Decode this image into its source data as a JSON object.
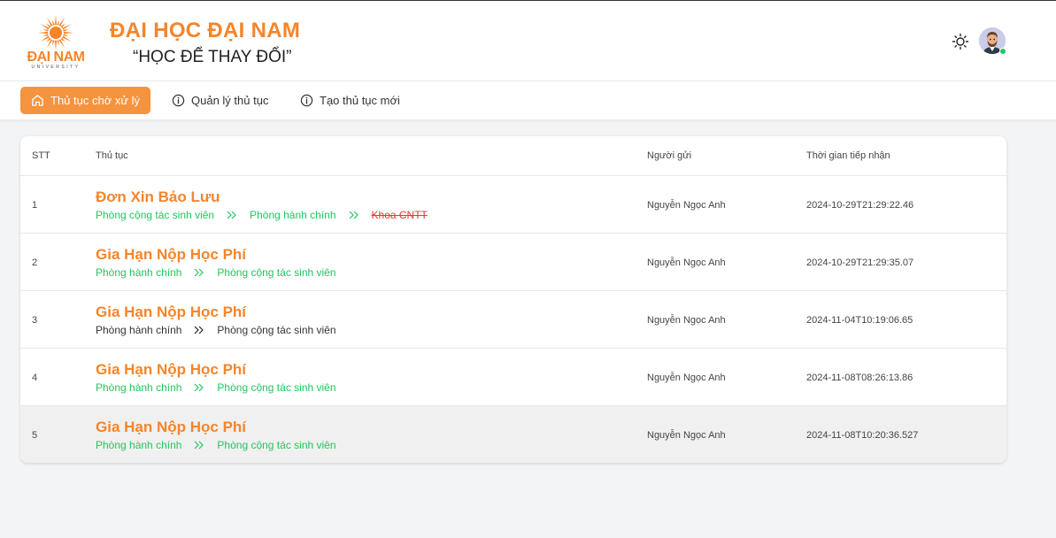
{
  "header": {
    "logo_text": "ĐẠI NAM",
    "logo_sub": "UNIVERSITY",
    "title": "ĐẠI HỌC ĐẠI NAM",
    "slogan": "“HỌC ĐỂ THAY ĐỔI”",
    "theme_icon": "sun-icon",
    "user_status_color": "#22c55e"
  },
  "tabs": [
    {
      "label": "Thủ tục chờ xử lý",
      "icon": "home-icon",
      "active": true
    },
    {
      "label": "Quản lý thủ tục",
      "icon": "info-icon",
      "active": false
    },
    {
      "label": "Tạo thủ tục mới",
      "icon": "info-icon",
      "active": false
    }
  ],
  "table": {
    "columns": [
      "STT",
      "Thủ tục",
      "Người gửi",
      "Thời gian tiếp nhận"
    ],
    "rows": [
      {
        "stt": "1",
        "name": "Đơn Xin Bảo Lưu",
        "steps": [
          {
            "label": "Phòng cộng tác sinh viên",
            "status": "done"
          },
          {
            "label": "Phòng hành chính",
            "status": "done"
          },
          {
            "label": "Khoa CNTT",
            "status": "rejected"
          }
        ],
        "sender": "Nguyễn Ngọc Anh",
        "time": "2024-10-29T21:29:22.46"
      },
      {
        "stt": "2",
        "name": "Gia Hạn Nộp Học Phí",
        "steps": [
          {
            "label": "Phòng hành chính",
            "status": "done"
          },
          {
            "label": "Phòng cộng tác sinh viên",
            "status": "done"
          }
        ],
        "sender": "Nguyễn Ngọc Anh",
        "time": "2024-10-29T21:29:35.07"
      },
      {
        "stt": "3",
        "name": "Gia Hạn Nộp Học Phí",
        "steps": [
          {
            "label": "Phòng hành chính",
            "status": "pending"
          },
          {
            "label": "Phòng cộng tác sinh viên",
            "status": "pending"
          }
        ],
        "sender": "Nguyễn Ngọc Anh",
        "time": "2024-11-04T10:19:06.65"
      },
      {
        "stt": "4",
        "name": "Gia Hạn Nộp Học Phí",
        "steps": [
          {
            "label": "Phòng hành chính",
            "status": "done"
          },
          {
            "label": "Phòng cộng tác sinh viên",
            "status": "done"
          }
        ],
        "sender": "Nguyễn Ngọc Anh",
        "time": "2024-11-08T08:26:13.86"
      },
      {
        "stt": "5",
        "name": "Gia Hạn Nộp Học Phí",
        "steps": [
          {
            "label": "Phòng hành chính",
            "status": "done"
          },
          {
            "label": "Phòng cộng tác sinh viên",
            "status": "done"
          }
        ],
        "sender": "Nguyễn Ngọc Anh",
        "time": "2024-11-08T10:20:36.527"
      }
    ]
  },
  "colors": {
    "brand": "#f5852a",
    "active_tab": "#f5933f",
    "step_done": "#22c55e",
    "step_pending": "#333333",
    "step_rejected": "#e53935"
  }
}
